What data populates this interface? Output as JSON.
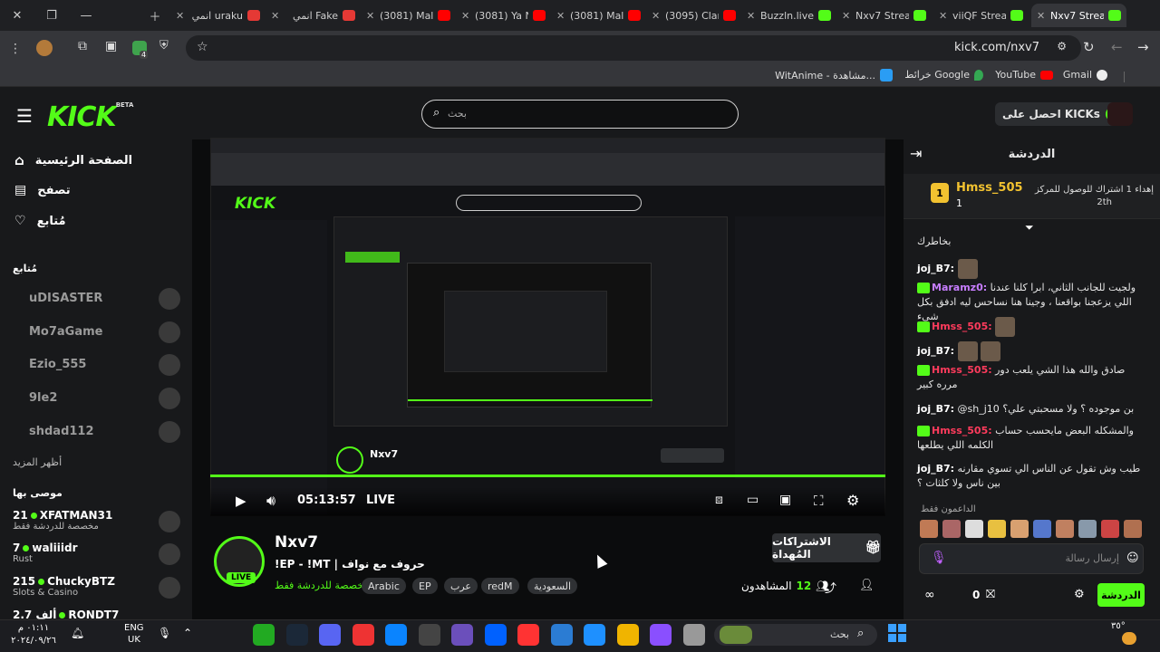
{
  "browser": {
    "tabs": [
      {
        "title": "انمي uraku",
        "fav": "#e53935"
      },
      {
        "title": "انمي Fake",
        "fav": "#e53935"
      },
      {
        "title": "(3081) Mal",
        "fav": "#ff0000"
      },
      {
        "title": "(3081) Ya N",
        "fav": "#ff0000"
      },
      {
        "title": "(3081) Mal",
        "fav": "#ff0000"
      },
      {
        "title": "(3095) Clar",
        "fav": "#ff0000"
      },
      {
        "title": "Buzzln.live",
        "fav": "#53fc18"
      },
      {
        "title": "Nxv7 Strea",
        "fav": "#53fc18"
      },
      {
        "title": "viiQF Strea",
        "fav": "#53fc18"
      },
      {
        "title": "Nxv7 Strea",
        "fav": "#53fc18"
      }
    ],
    "url": "kick.com/nxv7",
    "bookmarks": [
      "WitAnime - مشاهدة...",
      "خرائط Google",
      "YouTube",
      "Gmail"
    ],
    "extension_count": "4"
  },
  "header": {
    "logo": "KICK",
    "logo_sup": "BETA",
    "search_placeholder": "بحث",
    "get_kicks": "احصل على KICKs"
  },
  "sidebar": {
    "nav": [
      {
        "label": "الصفحة الرئيسية",
        "icon": "home-icon"
      },
      {
        "label": "تصفح",
        "icon": "browse-icon"
      },
      {
        "label": "مُتابع",
        "icon": "heart-icon"
      }
    ],
    "following_title": "مُتابع",
    "following": [
      "uDISASTER",
      "Mo7aGame",
      "Ezio_555",
      "9le2",
      "shdad112"
    ],
    "show_more": "أظهر المزيد",
    "recommended_title": "موصى بها",
    "recommended": [
      {
        "count": "21",
        "name": "XFATMAN31",
        "category": "مخصصة للدردشة فقط"
      },
      {
        "count": "7",
        "name": "waliiidr",
        "category": "Rust"
      },
      {
        "count": "215",
        "name": "ChuckyBTZ",
        "category": "Slots & Casino"
      },
      {
        "count": "2.7 ألف",
        "name": "RONDT7",
        "category": ""
      }
    ]
  },
  "player": {
    "time": "05:13:57",
    "live": "LIVE"
  },
  "stream": {
    "channel": "Nxv7",
    "live_badge": "LIVE",
    "title": "!EP - !MT | حروف مع نواف",
    "category": "مخصصة للدردشة فقط",
    "tags": [
      "Arabic",
      "EP",
      "عرب",
      "redM",
      "السعودية"
    ],
    "gift_button": "الاشتراكات المُهداة",
    "viewers_label": "المشاهدون",
    "viewers_count": "12"
  },
  "chat": {
    "title": "الدردشة",
    "pinned": {
      "user": "Hmss_505",
      "count": "1",
      "text": "إهداء 1 اشتراك للوصول للمركز",
      "rank": "2th"
    },
    "messages": [
      {
        "user": "",
        "text": "بخاطرك"
      },
      {
        "user": "joj_B7:",
        "text": ""
      },
      {
        "user": "Maramz0:",
        "text": "ولجيت للجانب الثاني، ابرا كلنا عندنا اللي يزعجنا بواقعنا ، وجينا هنا نساحس ليه ادفق بكل شيء"
      },
      {
        "user": "Hmss_505:",
        "text": ""
      },
      {
        "user": "joj_B7:",
        "text": ""
      },
      {
        "user": "Hmss_505:",
        "text": "صادق والله هذا الشي يلعب دور مرره كبير"
      },
      {
        "user": "joj_B7:",
        "text": "@sh_j10 بن موجوده ؟ ولا مسحبتي علي؟"
      },
      {
        "user": "Hmss_505:",
        "text": "والمشكله البعض مايحسب حساب الكلمه اللي يطلعها"
      },
      {
        "user": "joj_B7:",
        "text": "طيب وش تقول عن الناس الي تسوي مقارنه بين ناس ولا كلثات ؟"
      }
    ],
    "supporters_label": "الداعمون فقط",
    "input_placeholder": "إرسال رسالة",
    "send_button": "الدردشة",
    "kicks_count": "0"
  },
  "taskbar": {
    "time": "٠١:١١ م",
    "date": "٢٠٢٤/٠٩/٢٦",
    "lang": "ENG",
    "lang2": "UK",
    "search": "بحث",
    "temp": "٣٥°"
  }
}
